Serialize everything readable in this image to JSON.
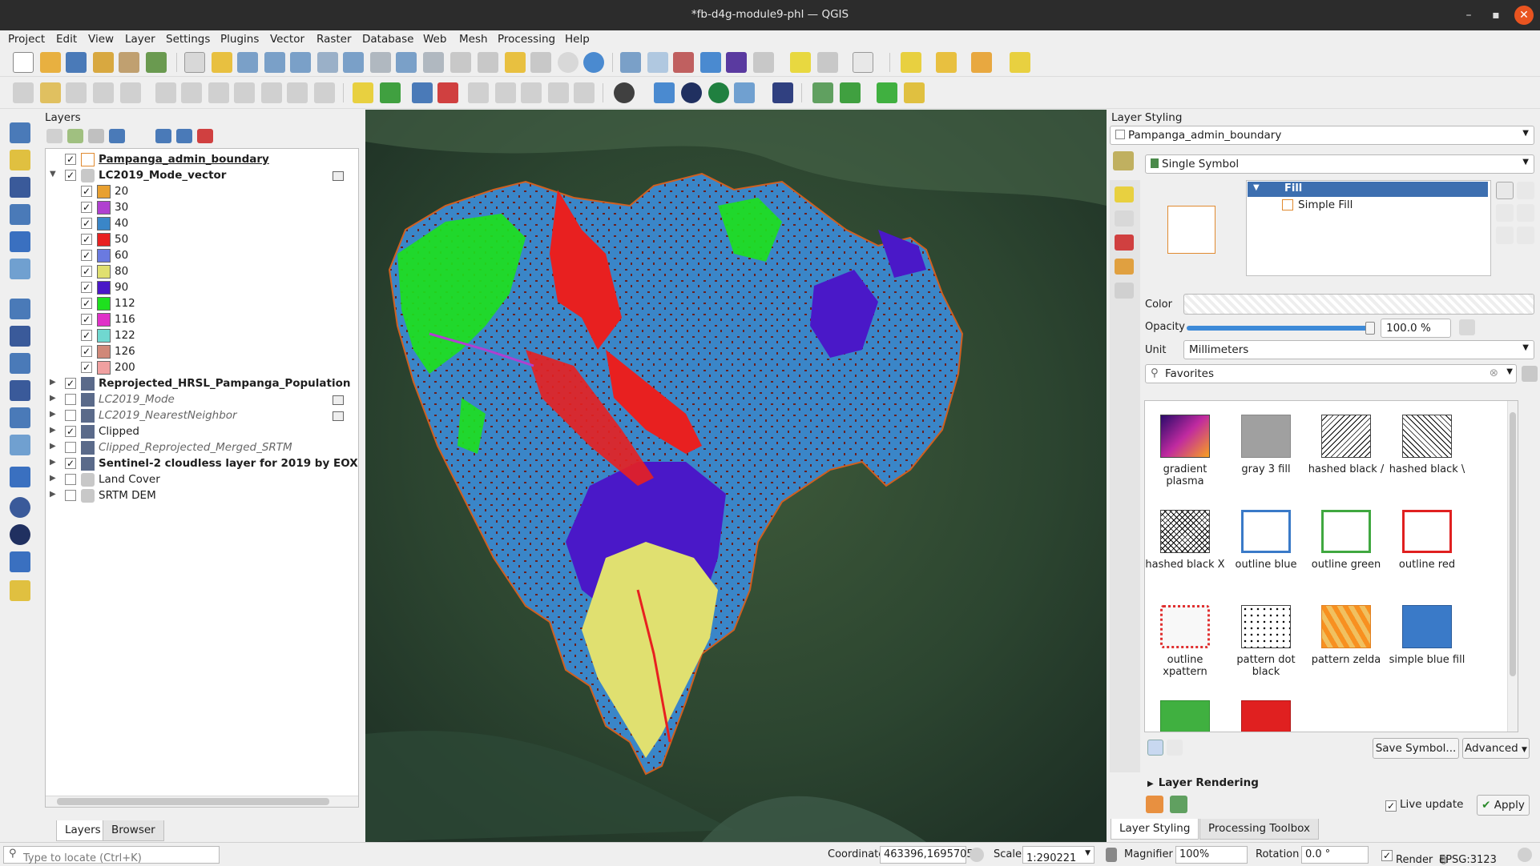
{
  "window": {
    "title": "*fb-d4g-module9-phl — QGIS",
    "minimize": "–",
    "maximize": "▪",
    "close": "✕"
  },
  "menu": [
    "Project",
    "Edit",
    "View",
    "Layer",
    "Settings",
    "Plugins",
    "Vector",
    "Raster",
    "Database",
    "Web",
    "Mesh",
    "Processing",
    "Help"
  ],
  "layers_panel": {
    "title": "Layers",
    "items": [
      {
        "label": "Pampanga_admin_boundary",
        "checked": true,
        "style": "bold under"
      },
      {
        "label": "LC2019_Mode_vector",
        "checked": true,
        "style": "bold",
        "expanded": true
      },
      {
        "label": "20",
        "color": "#e8a030",
        "checked": true
      },
      {
        "label": "30",
        "color": "#b040d0",
        "checked": true
      },
      {
        "label": "40",
        "color": "#3a86c8",
        "checked": true
      },
      {
        "label": "50",
        "color": "#e82020",
        "checked": true
      },
      {
        "label": "60",
        "color": "#6a7ae0",
        "checked": true
      },
      {
        "label": "80",
        "color": "#e0e070",
        "checked": true
      },
      {
        "label": "90",
        "color": "#4a18c8",
        "checked": true
      },
      {
        "label": "112",
        "color": "#1ee01e",
        "checked": true
      },
      {
        "label": "116",
        "color": "#e030c8",
        "checked": true
      },
      {
        "label": "122",
        "color": "#70d8d0",
        "checked": true
      },
      {
        "label": "126",
        "color": "#d08878",
        "checked": true
      },
      {
        "label": "200",
        "color": "#f0a0a0",
        "checked": true
      },
      {
        "label": "Reprojected_HRSL_Pampanga_Population",
        "checked": true,
        "style": "bold"
      },
      {
        "label": "LC2019_Mode",
        "checked": false,
        "style": "ital"
      },
      {
        "label": "LC2019_NearestNeighbor",
        "checked": false,
        "style": "ital"
      },
      {
        "label": "Clipped",
        "checked": true,
        "style": ""
      },
      {
        "label": "Clipped_Reprojected_Merged_SRTM",
        "checked": false,
        "style": "ital"
      },
      {
        "label": "Sentinel-2 cloudless layer for 2019 by EOX - ",
        "checked": true,
        "style": "bold"
      },
      {
        "label": "Land Cover",
        "checked": false,
        "style": ""
      },
      {
        "label": "SRTM DEM",
        "checked": false,
        "style": ""
      }
    ],
    "tabs": [
      "Layers",
      "Browser"
    ]
  },
  "styling": {
    "title": "Layer Styling",
    "layer_select": "Pampanga_admin_boundary",
    "renderer": "Single Symbol",
    "tree": {
      "fill": "Fill",
      "simple_fill": "Simple Fill"
    },
    "color_label": "Color",
    "opacity_label": "Opacity",
    "opacity_value": "100.0 %",
    "opacity_fraction": 1.0,
    "unit_label": "Unit",
    "unit_value": "Millimeters",
    "favorites": "Favorites",
    "symbols": [
      {
        "label": "gradient plasma"
      },
      {
        "label": "gray 3 fill"
      },
      {
        "label": "hashed black /"
      },
      {
        "label": "hashed black \\"
      },
      {
        "label": "hashed black X"
      },
      {
        "label": "outline blue"
      },
      {
        "label": "outline green"
      },
      {
        "label": "outline red"
      },
      {
        "label": "outline xpattern"
      },
      {
        "label": "pattern dot black"
      },
      {
        "label": "pattern zelda"
      },
      {
        "label": "simple blue fill"
      },
      {
        "label": ""
      },
      {
        "label": ""
      }
    ],
    "save_symbol": "Save Symbol...",
    "advanced": "Advanced",
    "layer_rendering": "Layer Rendering",
    "live_update": "Live update",
    "apply": "Apply",
    "tabs": [
      "Layer Styling",
      "Processing Toolbox"
    ]
  },
  "status": {
    "locate_placeholder": "Type to locate (Ctrl+K)",
    "coordinate_label": "Coordinate",
    "coordinate": "463396,1695705",
    "scale_label": "Scale",
    "scale": "1:290221",
    "magnifier_label": "Magnifier",
    "magnifier": "100%",
    "rotation_label": "Rotation",
    "rotation": "0.0 °",
    "render_label": "Render",
    "crs": "EPSG:3123"
  }
}
